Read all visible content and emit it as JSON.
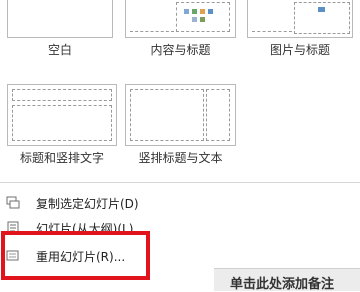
{
  "layouts": [
    {
      "label": "空白"
    },
    {
      "label": "内容与标题"
    },
    {
      "label": "图片与标题"
    },
    {
      "label": "标题和竖排文字"
    },
    {
      "label": "竖排标题与文本"
    }
  ],
  "menu": {
    "duplicate": "复制选定幻灯片(D)",
    "from_outline": "幻灯片(从大纲)(L)...",
    "reuse": "重用幻灯片(R)..."
  },
  "notes": {
    "placeholder": "单击此处添加备注"
  },
  "colors": {
    "highlight": "#e1131c"
  }
}
